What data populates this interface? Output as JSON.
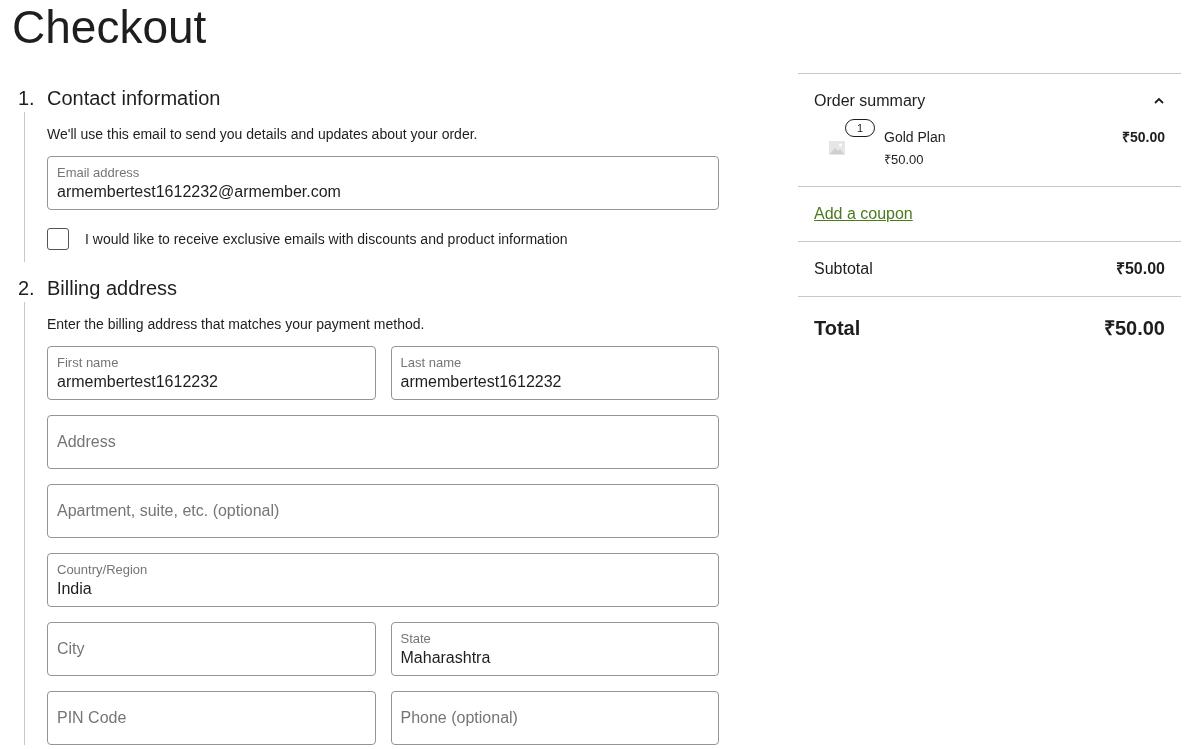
{
  "page": {
    "title": "Checkout"
  },
  "sections": [
    {
      "number": "1.",
      "heading": "Contact information",
      "description": "We'll use this email to send you details and updates about your order.",
      "rows": [
        [
          {
            "kind": "labeled",
            "label": "Email address",
            "value": "armembertest1612232@armember.com"
          }
        ]
      ],
      "checkbox": {
        "label": "I would like to receive exclusive emails with discounts and product information",
        "checked": false
      }
    },
    {
      "number": "2.",
      "heading": "Billing address",
      "description": "Enter the billing address that matches your payment method.",
      "rows": [
        [
          {
            "kind": "labeled",
            "label": "First name",
            "value": "armembertest1612232"
          },
          {
            "kind": "labeled",
            "label": "Last name",
            "value": "armembertest1612232"
          }
        ],
        [
          {
            "kind": "placeholder",
            "placeholder": "Address"
          }
        ],
        [
          {
            "kind": "placeholder",
            "placeholder": "Apartment, suite, etc. (optional)"
          }
        ],
        [
          {
            "kind": "labeled",
            "label": "Country/Region",
            "value": "India"
          }
        ],
        [
          {
            "kind": "placeholder",
            "placeholder": "City"
          },
          {
            "kind": "labeled",
            "label": "State",
            "value": "Maharashtra"
          }
        ],
        [
          {
            "kind": "placeholder",
            "placeholder": "PIN Code"
          },
          {
            "kind": "placeholder",
            "placeholder": "Phone (optional)"
          }
        ]
      ]
    }
  ],
  "order_summary": {
    "title": "Order summary",
    "expanded": true,
    "items": [
      {
        "quantity": "1",
        "name": "Gold Plan",
        "unit_price": "₹50.00",
        "line_total": "₹50.00"
      }
    ],
    "coupon_link": "Add a coupon",
    "subtotal": {
      "label": "Subtotal",
      "amount": "₹50.00"
    },
    "total": {
      "label": "Total",
      "amount": "₹50.00"
    }
  }
}
